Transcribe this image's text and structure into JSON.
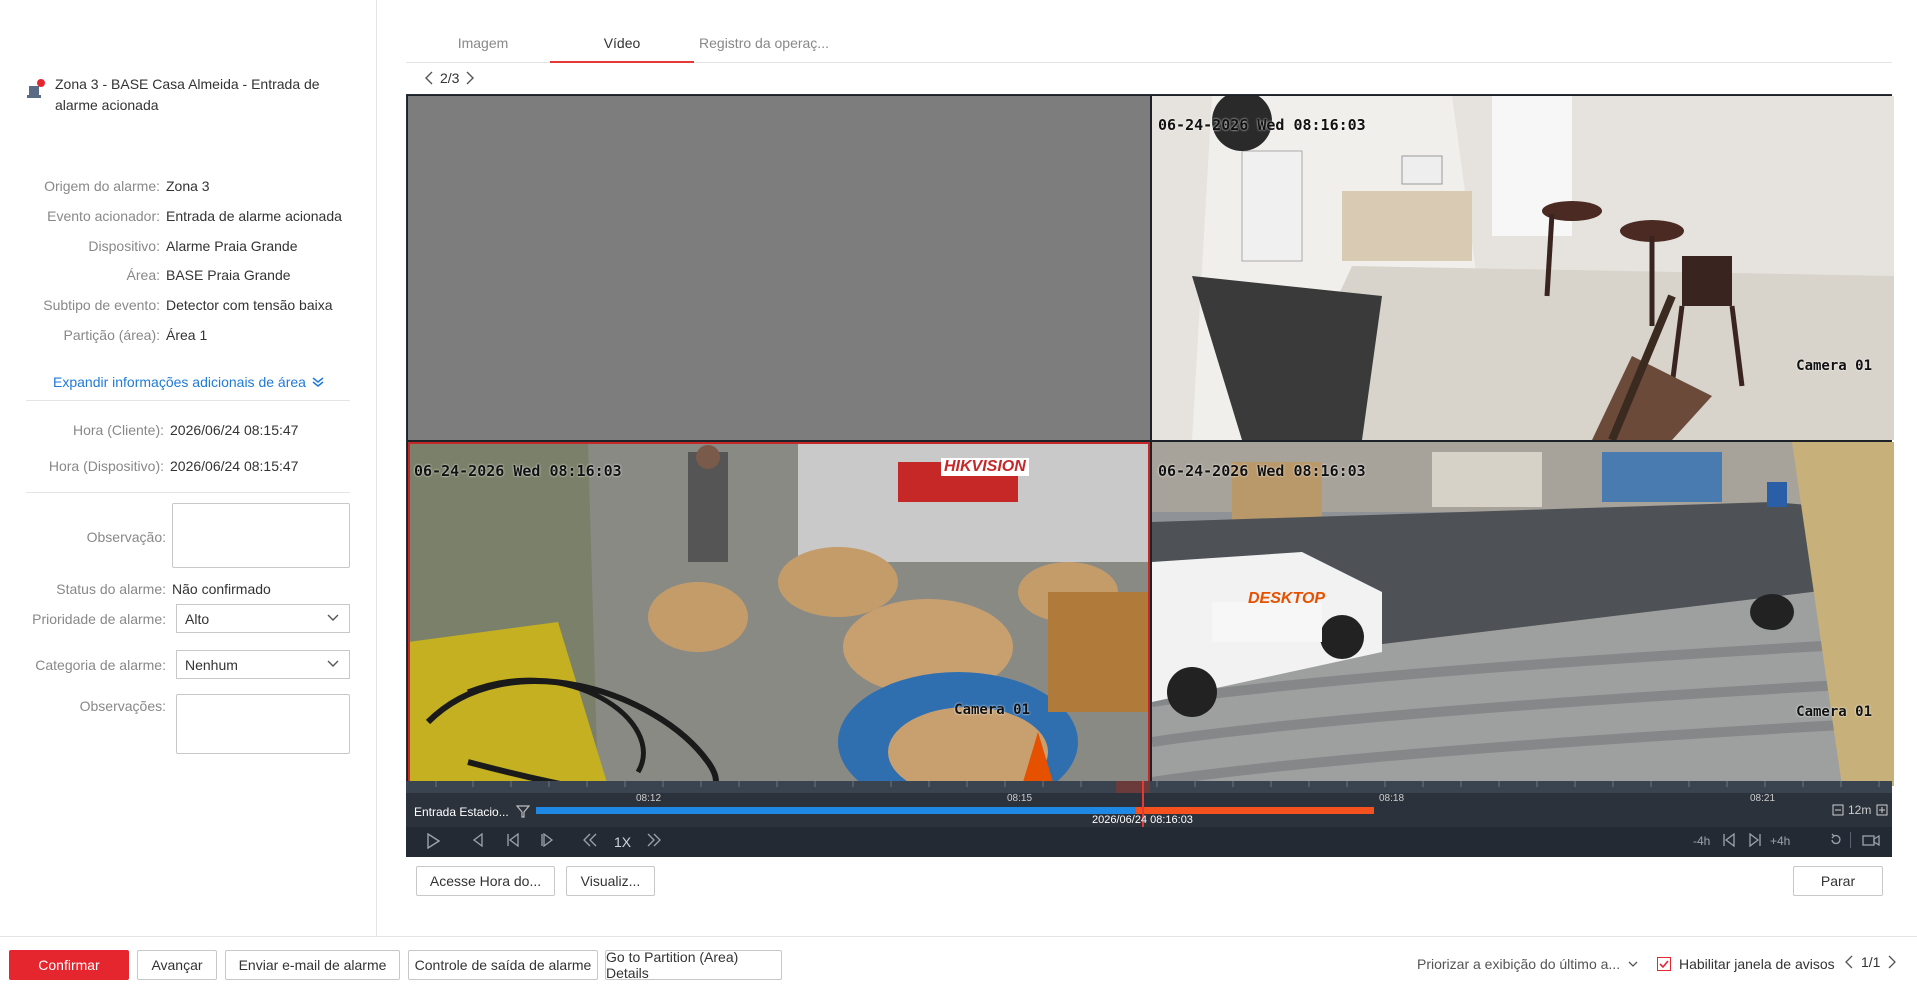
{
  "alarm": {
    "title": "Zona 3 - BASE Casa Almeida - Entrada de alarme acionada",
    "icon": "alarm-bell-icon",
    "fields": [
      {
        "label": "Origem do alarme:",
        "value": "Zona 3"
      },
      {
        "label": "Evento acionador:",
        "value": "Entrada de alarme acionada"
      },
      {
        "label": "Dispositivo:",
        "value": "Alarme Praia Grande"
      },
      {
        "label": "Área:",
        "value": "BASE Praia Grande"
      },
      {
        "label": "Subtipo de evento:",
        "value": "Detector com tensão baixa"
      },
      {
        "label": "Partição (área):",
        "value": "Área 1"
      }
    ],
    "expand_label": "Expandir informações adicionais de área",
    "times": [
      {
        "label": "Hora (Cliente):",
        "value": "2026/06/24 08:15:47"
      },
      {
        "label": "Hora (Dispositivo):",
        "value": "2026/06/24 08:15:47"
      }
    ],
    "observacao_label": "Observação:",
    "status_label": "Status do alarme:",
    "status_value": "Não confirmado",
    "priority_label": "Prioridade de alarme:",
    "priority_value": "Alto",
    "category_label": "Categoria de alarme:",
    "category_value": "Nenhum",
    "observacoes_label": "Observações:"
  },
  "tabs": [
    "Imagem",
    "Vídeo",
    "Registro da operaç..."
  ],
  "active_tab": 1,
  "pager": "2/3",
  "video": {
    "tiles": [
      {
        "osd": "",
        "cam": ""
      },
      {
        "osd": "06-24-2026 Wed 08:16:03",
        "cam": "Camera 01"
      },
      {
        "osd": "06-24-2026 Wed 08:16:03",
        "cam": "Camera 01",
        "brand": "HIKVISION"
      },
      {
        "osd": "06-24-2026 Wed 08:16:03",
        "cam": "Camera 01",
        "vehicle_brand": "DESKTOP"
      }
    ],
    "timeline": {
      "label": "Entrada Estacio...",
      "ticks": [
        "08:12",
        "08:15",
        "08:18",
        "08:21"
      ],
      "cursor_time": "2026/06/24 08:16:03",
      "zoom": "12m"
    },
    "controls": {
      "speed": "1X",
      "back": "-4h",
      "forward": "+4h"
    }
  },
  "video_buttons": {
    "acesse": "Acesse Hora do...",
    "visualiz": "Visualiz...",
    "parar": "Parar"
  },
  "footer": {
    "confirmar": "Confirmar",
    "avancar": "Avançar",
    "email": "Enviar e-mail de alarme",
    "saida": "Controle de saída de alarme",
    "partition": "Go to Partition (Area) Details",
    "priorizar": "Priorizar a exibição do último a...",
    "habilitar": "Habilitar janela de avisos",
    "pages": "1/1"
  },
  "colors": {
    "accent": "#e5262f",
    "link": "#1f7ad8",
    "timeline_blue": "#1e88e5",
    "timeline_orange": "#f4511e"
  }
}
